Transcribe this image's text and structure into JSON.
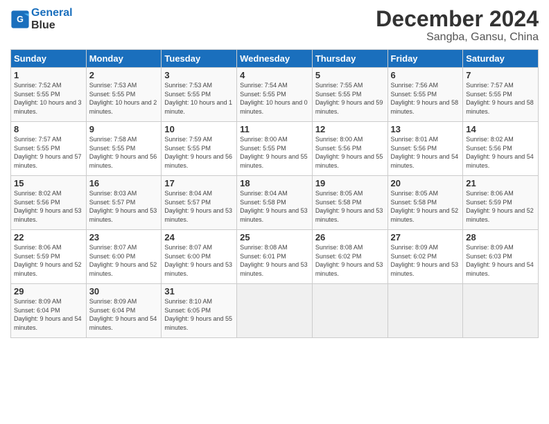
{
  "header": {
    "logo_line1": "General",
    "logo_line2": "Blue",
    "month": "December 2024",
    "location": "Sangba, Gansu, China"
  },
  "days_of_week": [
    "Sunday",
    "Monday",
    "Tuesday",
    "Wednesday",
    "Thursday",
    "Friday",
    "Saturday"
  ],
  "weeks": [
    [
      {
        "day": "1",
        "sunrise": "7:52 AM",
        "sunset": "5:55 PM",
        "daylight": "10 hours and 3 minutes."
      },
      {
        "day": "2",
        "sunrise": "7:53 AM",
        "sunset": "5:55 PM",
        "daylight": "10 hours and 2 minutes."
      },
      {
        "day": "3",
        "sunrise": "7:53 AM",
        "sunset": "5:55 PM",
        "daylight": "10 hours and 1 minute."
      },
      {
        "day": "4",
        "sunrise": "7:54 AM",
        "sunset": "5:55 PM",
        "daylight": "10 hours and 0 minutes."
      },
      {
        "day": "5",
        "sunrise": "7:55 AM",
        "sunset": "5:55 PM",
        "daylight": "9 hours and 59 minutes."
      },
      {
        "day": "6",
        "sunrise": "7:56 AM",
        "sunset": "5:55 PM",
        "daylight": "9 hours and 58 minutes."
      },
      {
        "day": "7",
        "sunrise": "7:57 AM",
        "sunset": "5:55 PM",
        "daylight": "9 hours and 58 minutes."
      }
    ],
    [
      {
        "day": "8",
        "sunrise": "7:57 AM",
        "sunset": "5:55 PM",
        "daylight": "9 hours and 57 minutes."
      },
      {
        "day": "9",
        "sunrise": "7:58 AM",
        "sunset": "5:55 PM",
        "daylight": "9 hours and 56 minutes."
      },
      {
        "day": "10",
        "sunrise": "7:59 AM",
        "sunset": "5:55 PM",
        "daylight": "9 hours and 56 minutes."
      },
      {
        "day": "11",
        "sunrise": "8:00 AM",
        "sunset": "5:55 PM",
        "daylight": "9 hours and 55 minutes."
      },
      {
        "day": "12",
        "sunrise": "8:00 AM",
        "sunset": "5:56 PM",
        "daylight": "9 hours and 55 minutes."
      },
      {
        "day": "13",
        "sunrise": "8:01 AM",
        "sunset": "5:56 PM",
        "daylight": "9 hours and 54 minutes."
      },
      {
        "day": "14",
        "sunrise": "8:02 AM",
        "sunset": "5:56 PM",
        "daylight": "9 hours and 54 minutes."
      }
    ],
    [
      {
        "day": "15",
        "sunrise": "8:02 AM",
        "sunset": "5:56 PM",
        "daylight": "9 hours and 53 minutes."
      },
      {
        "day": "16",
        "sunrise": "8:03 AM",
        "sunset": "5:57 PM",
        "daylight": "9 hours and 53 minutes."
      },
      {
        "day": "17",
        "sunrise": "8:04 AM",
        "sunset": "5:57 PM",
        "daylight": "9 hours and 53 minutes."
      },
      {
        "day": "18",
        "sunrise": "8:04 AM",
        "sunset": "5:58 PM",
        "daylight": "9 hours and 53 minutes."
      },
      {
        "day": "19",
        "sunrise": "8:05 AM",
        "sunset": "5:58 PM",
        "daylight": "9 hours and 53 minutes."
      },
      {
        "day": "20",
        "sunrise": "8:05 AM",
        "sunset": "5:58 PM",
        "daylight": "9 hours and 52 minutes."
      },
      {
        "day": "21",
        "sunrise": "8:06 AM",
        "sunset": "5:59 PM",
        "daylight": "9 hours and 52 minutes."
      }
    ],
    [
      {
        "day": "22",
        "sunrise": "8:06 AM",
        "sunset": "5:59 PM",
        "daylight": "9 hours and 52 minutes."
      },
      {
        "day": "23",
        "sunrise": "8:07 AM",
        "sunset": "6:00 PM",
        "daylight": "9 hours and 52 minutes."
      },
      {
        "day": "24",
        "sunrise": "8:07 AM",
        "sunset": "6:00 PM",
        "daylight": "9 hours and 53 minutes."
      },
      {
        "day": "25",
        "sunrise": "8:08 AM",
        "sunset": "6:01 PM",
        "daylight": "9 hours and 53 minutes."
      },
      {
        "day": "26",
        "sunrise": "8:08 AM",
        "sunset": "6:02 PM",
        "daylight": "9 hours and 53 minutes."
      },
      {
        "day": "27",
        "sunrise": "8:09 AM",
        "sunset": "6:02 PM",
        "daylight": "9 hours and 53 minutes."
      },
      {
        "day": "28",
        "sunrise": "8:09 AM",
        "sunset": "6:03 PM",
        "daylight": "9 hours and 54 minutes."
      }
    ],
    [
      {
        "day": "29",
        "sunrise": "8:09 AM",
        "sunset": "6:04 PM",
        "daylight": "9 hours and 54 minutes."
      },
      {
        "day": "30",
        "sunrise": "8:09 AM",
        "sunset": "6:04 PM",
        "daylight": "9 hours and 54 minutes."
      },
      {
        "day": "31",
        "sunrise": "8:10 AM",
        "sunset": "6:05 PM",
        "daylight": "9 hours and 55 minutes."
      },
      null,
      null,
      null,
      null
    ]
  ],
  "labels": {
    "sunrise": "Sunrise:",
    "sunset": "Sunset:",
    "daylight": "Daylight:"
  }
}
